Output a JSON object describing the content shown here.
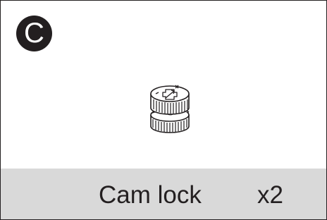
{
  "part": {
    "letter": "C",
    "name": "Cam lock",
    "quantity": "x2",
    "icon": "cam-lock-icon"
  },
  "colors": {
    "border": "#231f20",
    "badge": "#231f20",
    "badge_text": "#ffffff",
    "footer": "#d9d9d9",
    "text": "#231f20"
  }
}
